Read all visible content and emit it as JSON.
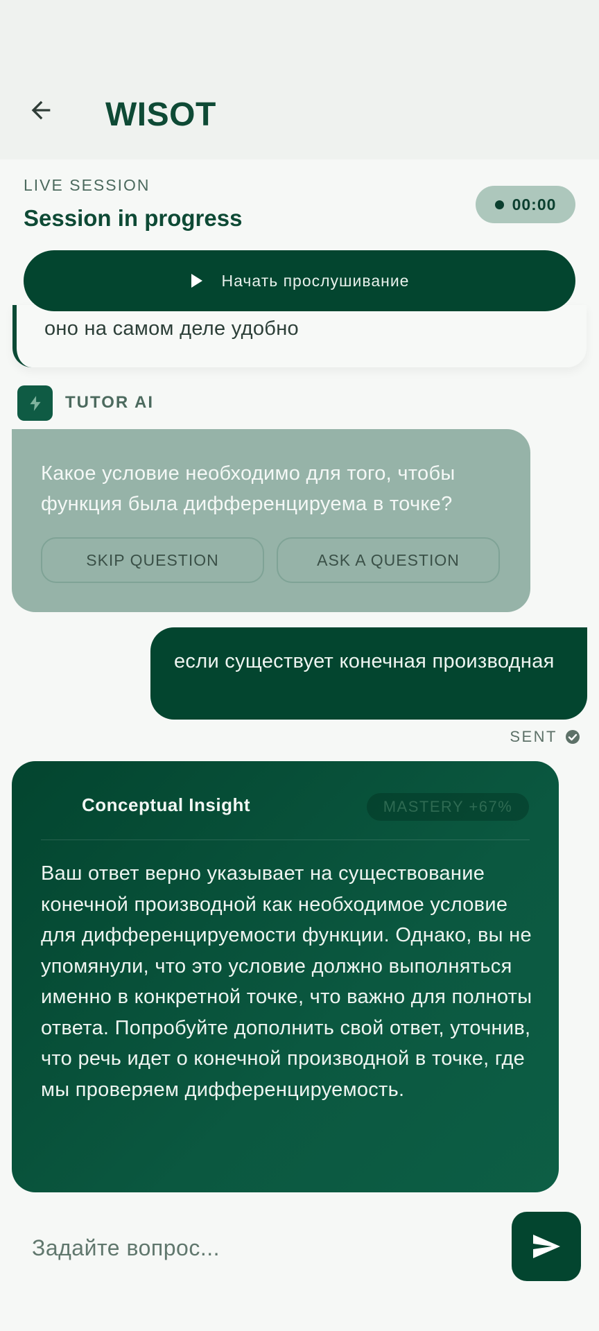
{
  "header": {
    "title": "WISOT"
  },
  "session": {
    "label": "LIVE SESSION",
    "status": "Session in progress",
    "timer": "00:00"
  },
  "listen_button": {
    "label": "Начать прослушивание"
  },
  "previous_message": {
    "text": "оно на самом деле удобно"
  },
  "tutor": {
    "name": "TUTOR AI"
  },
  "question": {
    "text": "Какое условие необходимо для того, чтобы функция была дифференцируема в точке?",
    "skip_label": "SKIP QUESTION",
    "ask_label": "ASK A QUESTION"
  },
  "user_message": {
    "text": "если существует конечная производная",
    "status": "SENT"
  },
  "insight": {
    "title": "Conceptual Insight",
    "mastery": "MASTERY +67%",
    "body": "Ваш ответ верно указывает на существование конечной производной как необходимое условие для дифференцируемости функции. Однако, вы не упомянули, что это условие должно выполняться именно в конкретной точке, что важно для полноты ответа. Попробуйте дополнить свой ответ, уточнив, что речь идет о конечной производной в точке, где мы проверяем дифференцируемость."
  },
  "composer": {
    "placeholder": "Задайте вопрос..."
  },
  "colors": {
    "primary": "#03452f",
    "accent_soft": "#96b3a8",
    "timer_bg": "#adc7bc",
    "background": "#f6f8f6"
  },
  "icons": {
    "back": "arrow-left-icon",
    "play": "play-icon",
    "tutor": "lightning-bolt-icon",
    "sent": "check-circle-icon",
    "send": "send-icon"
  }
}
